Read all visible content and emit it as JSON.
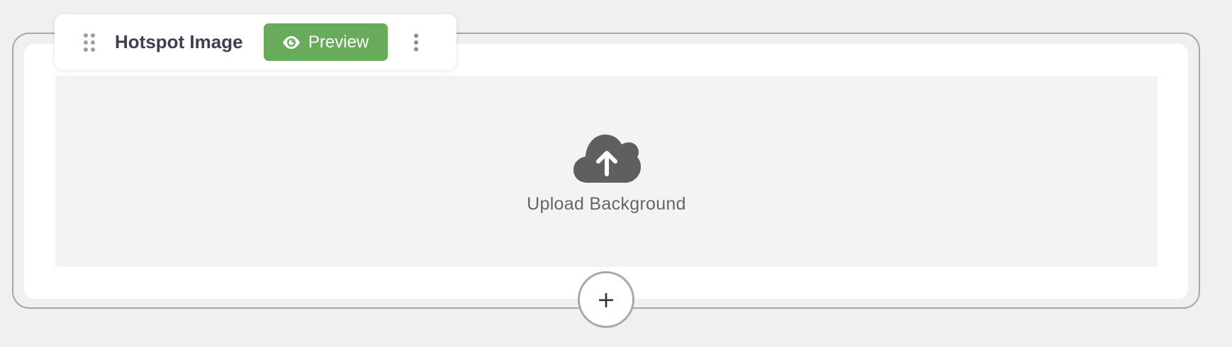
{
  "block": {
    "title": "Hotspot Image",
    "preview_label": "Preview",
    "drag_icon": "drag-handle-icon",
    "more_icon": "more-vertical-icon",
    "preview_icon": "eye-icon"
  },
  "upload": {
    "label": "Upload Background",
    "icon": "cloud-upload-icon"
  },
  "add_block": {
    "label": "+"
  },
  "colors": {
    "preview_button": "#67ab5b",
    "frame_border": "#a4a8b2",
    "upload_icon": "#5f5f5f",
    "title_text": "#3c4150"
  }
}
